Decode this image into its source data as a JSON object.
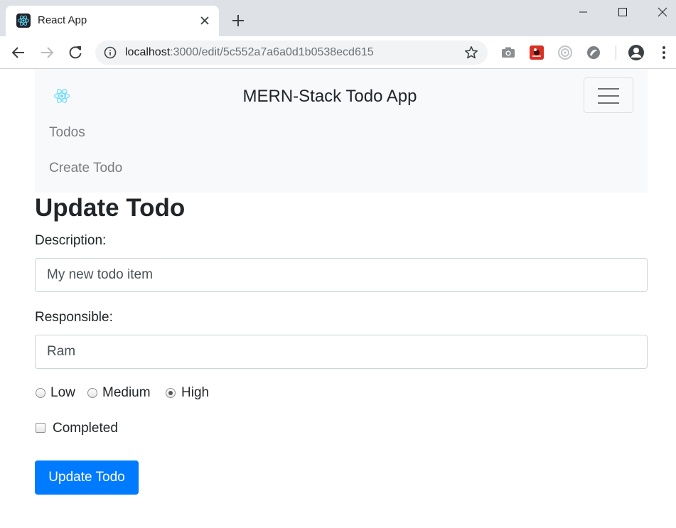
{
  "browser": {
    "tab_title": "React App",
    "url_host": "localhost",
    "url_path": ":3000/edit/5c552a7a6a0d1b0538ecd615",
    "icons": [
      "react-favicon-icon",
      "close-icon",
      "plus-icon",
      "back-arrow-icon",
      "forward-arrow-icon",
      "reload-icon",
      "info-icon",
      "star-icon",
      "camera-icon",
      "extension-icon",
      "extension-icon",
      "extension-icon",
      "profile-icon",
      "more-vert-icon"
    ]
  },
  "navbar": {
    "brand": "MERN-Stack Todo App",
    "links": [
      "Todos",
      "Create Todo"
    ],
    "logo_color": "#61dafb"
  },
  "form": {
    "title": "Update Todo",
    "description_label": "Description:",
    "description_value": "My new todo item",
    "responsible_label": "Responsible:",
    "responsible_value": "Ram",
    "priority_options": [
      "Low",
      "Medium",
      "High"
    ],
    "priority_selected": "High",
    "completed_label": "Completed",
    "completed_checked": false,
    "submit_label": "Update Todo"
  },
  "colors": {
    "primary": "#007bff",
    "navbar_bg": "#f8f9fa",
    "chrome_bg": "#dee1e6"
  }
}
